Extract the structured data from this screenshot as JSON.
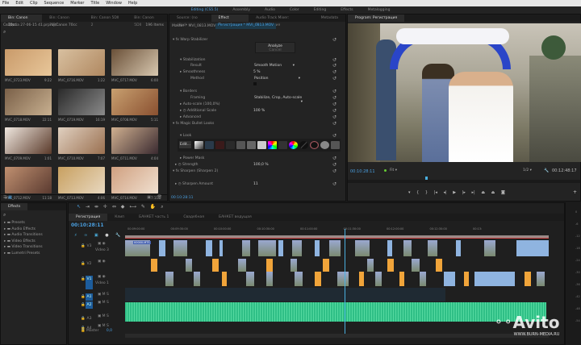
{
  "menu": [
    "File",
    "Edit",
    "Clip",
    "Sequence",
    "Marker",
    "Title",
    "Window",
    "Help"
  ],
  "workspaces": [
    "Editing (CS5.5)",
    "Assembly",
    "Audio",
    "Color",
    "Editing",
    "Effects",
    "Metalogging"
  ],
  "project": {
    "tabs": [
      "Bin: Canon 70сс",
      "Bin: Canon 70сс",
      "Bin: Canon 5DII 2",
      "Bin: Canon 5DII"
    ],
    "path": "Свадьба 27-06-15 41.prproj\\Canon 70сс",
    "count": "196 Items",
    "clips": [
      {
        "name": "MVC_0723.MOV",
        "dur": "9:22"
      },
      {
        "name": "MVC_0716.MOV",
        "dur": "1:22"
      },
      {
        "name": "MVC_0717.MOV",
        "dur": "6:00"
      },
      {
        "name": "MVC_0718.MOV",
        "dur": "22:11"
      },
      {
        "name": "MVC_0719.MOV",
        "dur": "16:19"
      },
      {
        "name": "MVC_0708.MOV",
        "dur": "5:11"
      },
      {
        "name": "MVC_0709.MOV",
        "dur": "1:01"
      },
      {
        "name": "MVC_0710.MOV",
        "dur": "7:07"
      },
      {
        "name": "MVC_0711.MOV",
        "dur": "4:04"
      },
      {
        "name": "MVC_0712.MOV",
        "dur": "11:18"
      },
      {
        "name": "MVC_0713.MOV",
        "dur": "4:06"
      },
      {
        "name": "MVC_0714.MOV",
        "dur": "7:11"
      }
    ]
  },
  "effect_controls": {
    "tabs": [
      "Source: (no clips)",
      "Effect Controls",
      "Audio Track Mixer: Регистрация",
      "Metadata"
    ],
    "master": "Master * MVI_0813.MOV",
    "sequence": "Регистрация * MVI_0813.MOV",
    "warp": "Warp Stabilizer",
    "analyze": "Analyze",
    "cancel": "Cancel",
    "stabilization": "Stabilization",
    "result": "Result",
    "result_val": "Smooth Motion",
    "smoothness": "Smoothness",
    "smoothness_val": "5 %",
    "method": "Method",
    "method_val": "Position",
    "borders": "Borders",
    "framing": "Framing",
    "framing_val": "Stabilize, Crop, Auto-scale",
    "autoscale": "Auto-scale (100,0%)",
    "addscale": "Additional Scale",
    "addscale_val": "100 %",
    "advanced": "Advanced",
    "mbl": "Magic Bullet Looks",
    "look": "Look",
    "edit": "Edit...",
    "powermask": "Power Mask",
    "strength": "Strength",
    "strength_val": "100,0 %",
    "sharpen": "Sharpen (Sharpen 2)",
    "sharpen_amt": "Sharpen Amount",
    "sharpen_val": "11",
    "timecode": "00:10:28:11"
  },
  "program": {
    "title": "Program: Регистрация",
    "timecode": "00:10:28:11",
    "fit": "Fit",
    "res": "1/2",
    "duration": "00:12:48:17"
  },
  "effects": {
    "title": "Effects",
    "items": [
      "Presets",
      "Audio Effects",
      "Audio Transitions",
      "Video Effects",
      "Video Transitions",
      "Lumetri Presets"
    ]
  },
  "timeline": {
    "tabs": [
      "Регистрация",
      "Клип",
      "БАНКЕТ часть 1",
      "Свадебная",
      "БАНКЕТ ведущая"
    ],
    "timecode": "00:10:28:11",
    "ruler": [
      "00:09:00:00",
      "00:09:30:00",
      "00:10:00:00",
      "00:10:30:00",
      "00:11:00:00",
      "00:11:30:00",
      "00:12:00:00",
      "00:12:30:00",
      "00:13:"
    ],
    "tracks": [
      {
        "id": "V3",
        "name": "Video 3"
      },
      {
        "id": "V2",
        "name": ""
      },
      {
        "id": "V1",
        "name": "Video 1"
      },
      {
        "id": "A1"
      },
      {
        "id": "A2"
      },
      {
        "id": "A3"
      },
      {
        "id": "A4"
      }
    ],
    "master": "Master",
    "master_val": "0,0",
    "clip_label": "00000.MTS"
  },
  "meters": [
    "0",
    "-6",
    "-12",
    "-18",
    "-24",
    "-30",
    "-36",
    "-42",
    "-48",
    "-54"
  ],
  "watermark": {
    "brand": "Avito",
    "url": "WWW.BURN-MEDIA.RU"
  },
  "colors": {
    "accent": "#4a9fe0",
    "video_clip": "#8fb4e0",
    "adjust_clip": "#f0a43a",
    "audio": "#2fbf86"
  }
}
